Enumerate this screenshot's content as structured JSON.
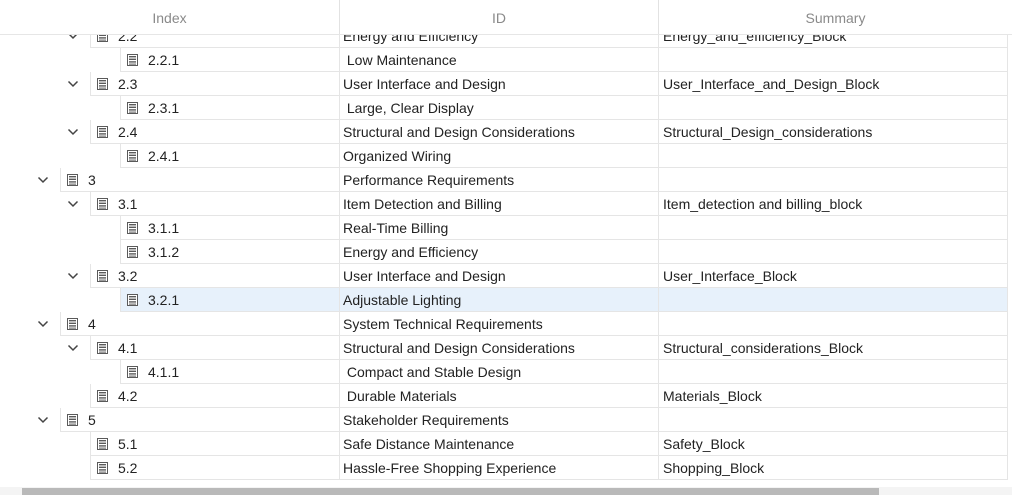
{
  "columns": {
    "index": "Index",
    "id": "ID",
    "summary": "Summary"
  },
  "rows": [
    {
      "level": 2,
      "expandable": true,
      "index": "2.2",
      "id": "Energy and Efficiency",
      "summary": "Energy_and_efficiency_Block",
      "selected": false
    },
    {
      "level": 3,
      "expandable": false,
      "index": "2.2.1",
      "id": " Low Maintenance",
      "summary": "",
      "selected": false
    },
    {
      "level": 2,
      "expandable": true,
      "index": "2.3",
      "id": "User Interface and Design",
      "summary": "User_Interface_and_Design_Block",
      "selected": false
    },
    {
      "level": 3,
      "expandable": false,
      "index": "2.3.1",
      "id": " Large, Clear Display",
      "summary": "",
      "selected": false
    },
    {
      "level": 2,
      "expandable": true,
      "index": "2.4",
      "id": "Structural and Design Considerations",
      "summary": "Structural_Design_considerations",
      "selected": false
    },
    {
      "level": 3,
      "expandable": false,
      "index": "2.4.1",
      "id": "Organized Wiring",
      "summary": "",
      "selected": false
    },
    {
      "level": 1,
      "expandable": true,
      "index": "3",
      "id": "Performance Requirements",
      "summary": "",
      "selected": false
    },
    {
      "level": 2,
      "expandable": true,
      "index": "3.1",
      "id": "Item Detection and Billing",
      "summary": "Item_detection and billing_block",
      "selected": false
    },
    {
      "level": 3,
      "expandable": false,
      "index": "3.1.1",
      "id": "Real-Time Billing",
      "summary": "",
      "selected": false
    },
    {
      "level": 3,
      "expandable": false,
      "index": "3.1.2",
      "id": "Energy and Efficiency",
      "summary": "",
      "selected": false
    },
    {
      "level": 2,
      "expandable": true,
      "index": "3.2",
      "id": "User Interface and Design",
      "summary": "User_Interface_Block",
      "selected": false
    },
    {
      "level": 3,
      "expandable": false,
      "index": "3.2.1",
      "id": "Adjustable Lighting",
      "summary": "",
      "selected": true
    },
    {
      "level": 1,
      "expandable": true,
      "index": "4",
      "id": "System Technical Requirements",
      "summary": "",
      "selected": false
    },
    {
      "level": 2,
      "expandable": true,
      "index": "4.1",
      "id": "Structural and Design Considerations",
      "summary": "Structural_considerations_Block",
      "selected": false
    },
    {
      "level": 3,
      "expandable": false,
      "index": "4.1.1",
      "id": " Compact and Stable Design",
      "summary": "",
      "selected": false
    },
    {
      "level": 2,
      "expandable": false,
      "index": "4.2",
      "id": " Durable Materials",
      "summary": "Materials_Block",
      "selected": false
    },
    {
      "level": 1,
      "expandable": true,
      "index": "5",
      "id": "Stakeholder Requirements",
      "summary": "",
      "selected": false
    },
    {
      "level": 2,
      "expandable": false,
      "index": "5.1",
      "id": "Safe Distance Maintenance",
      "summary": "Safety_Block",
      "selected": false
    },
    {
      "level": 2,
      "expandable": false,
      "index": "5.2",
      "id": "Hassle-Free Shopping Experience",
      "summary": "Shopping_Block",
      "selected": false
    }
  ],
  "icons": {
    "toggle": "chevron-down-icon",
    "node": "document-icon"
  },
  "colors": {
    "selection": "#e7f1fb",
    "gridline": "#e5e5e5",
    "header_text": "#8a8a8a",
    "scroll_thumb": "#b9b9b9"
  }
}
